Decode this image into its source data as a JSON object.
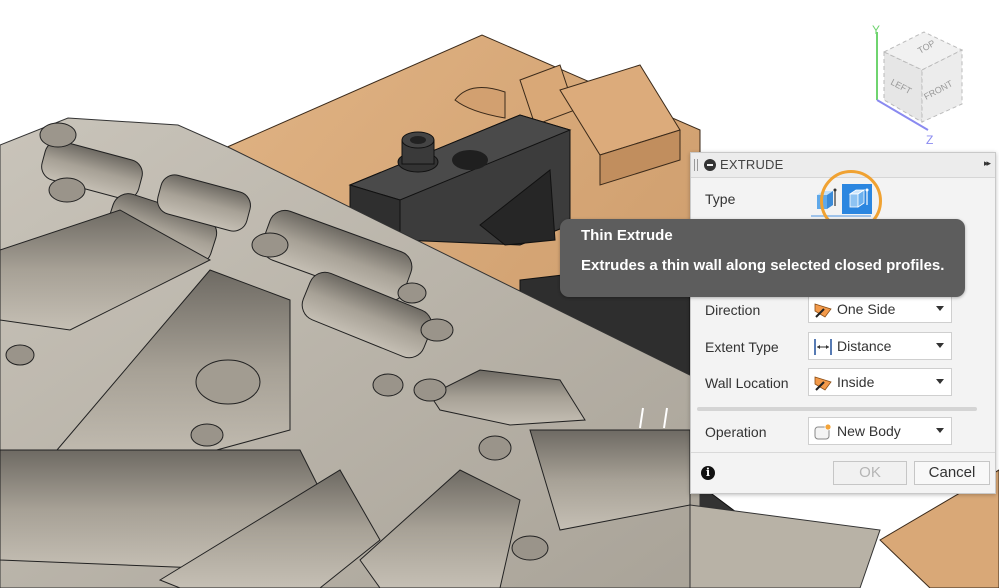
{
  "panel": {
    "title": "EXTRUDE",
    "type_label": "Type",
    "type_options": [
      {
        "name": "Extrude",
        "selected": false
      },
      {
        "name": "Thin Extrude",
        "selected": true
      }
    ],
    "rows": [
      {
        "label": "Direction",
        "value": "One Side",
        "icon": "direction-icon"
      },
      {
        "label": "Extent Type",
        "value": "Distance",
        "icon": "distance-icon"
      },
      {
        "label": "Wall Location",
        "value": "Inside",
        "icon": "wall-location-icon"
      },
      {
        "label": "Operation",
        "value": "New Body",
        "icon": "new-body-icon"
      }
    ],
    "ok_label": "OK",
    "cancel_label": "Cancel",
    "info_glyph": "i",
    "expand_glyph": "▸▸"
  },
  "tooltip": {
    "title": "Thin Extrude",
    "body": "Extrudes a thin wall along selected closed profiles."
  },
  "viewcube": {
    "faces": [
      "TOP",
      "LEFT",
      "FRONT"
    ],
    "axes": [
      "Y",
      "Z"
    ]
  },
  "colors": {
    "accent_blue": "#2b86e0",
    "highlight_orange": "#f0a232",
    "tooltip_bg": "#5d5d5d",
    "wood": "#d9a877",
    "metal": "#b3ada2",
    "clamp": "#3a3a3a"
  }
}
